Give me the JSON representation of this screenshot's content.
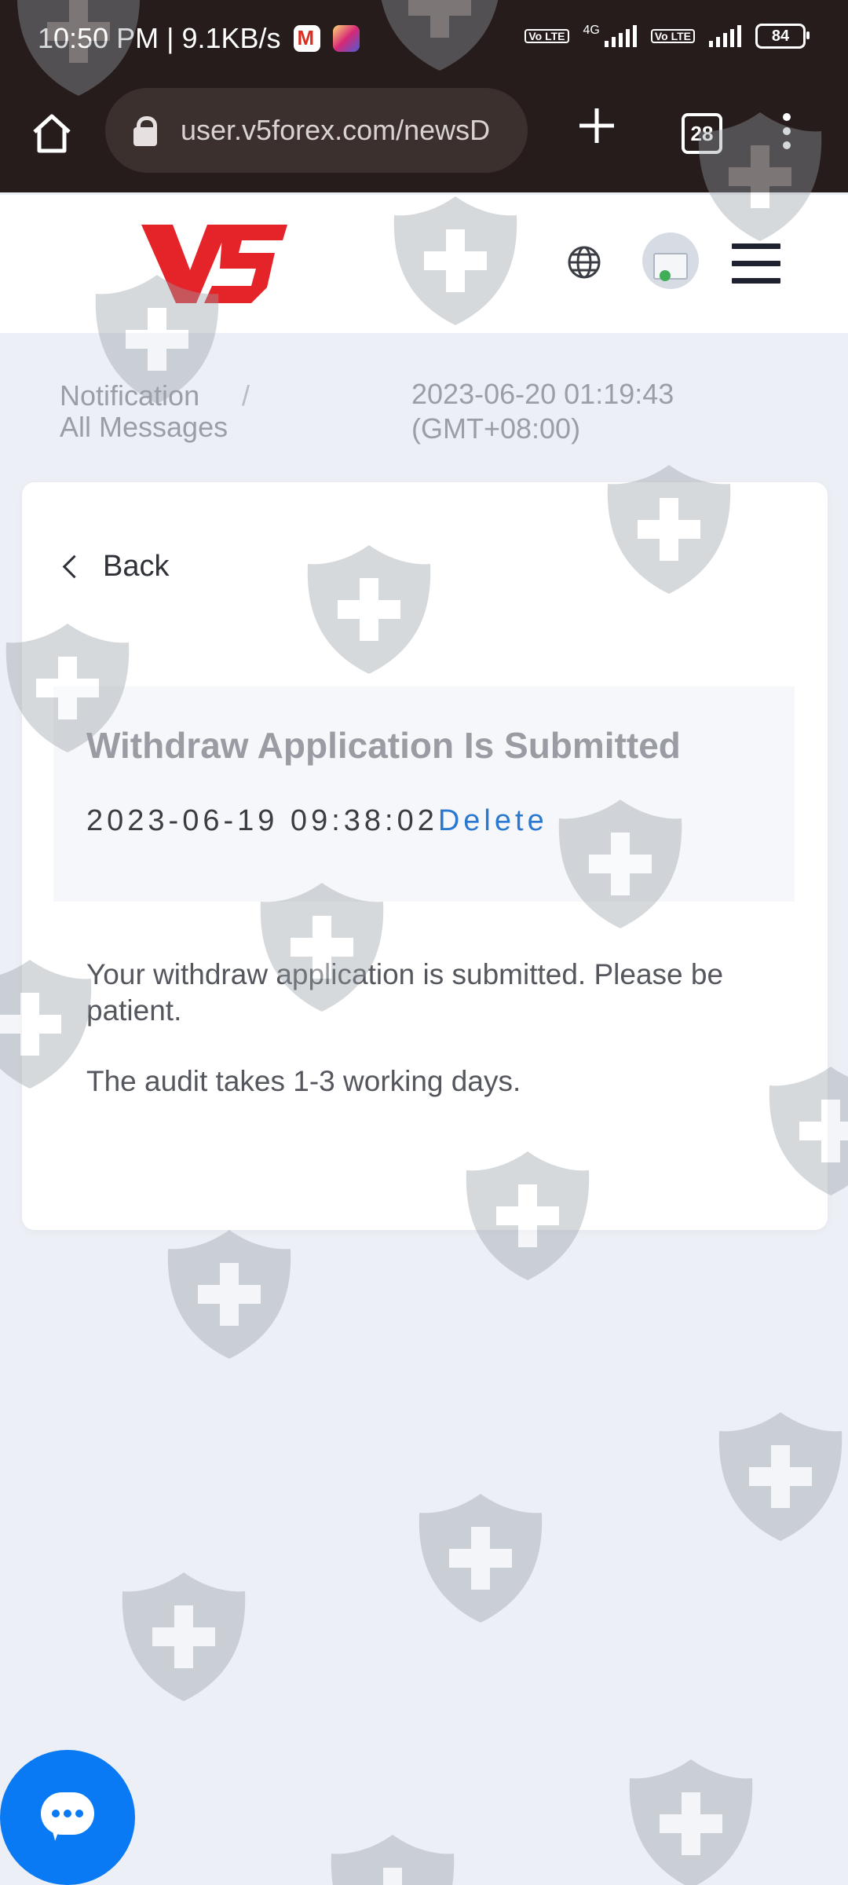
{
  "status_bar": {
    "time_speed": "10:50 PM | 9.1KB/s",
    "network": "4G",
    "volte": "Vo LTE",
    "battery": "84"
  },
  "browser": {
    "url": "user.v5forex.com/newsD",
    "tab_count": "28"
  },
  "site": {
    "logo_text": "V5"
  },
  "breadcrumb": {
    "parent": "Notification",
    "separator": "/",
    "current": "All Messages"
  },
  "server_time": {
    "datetime": "2023-06-20 01:19:43",
    "timezone": "(GMT+08:00)"
  },
  "card": {
    "back_label": "Back",
    "message": {
      "title": "Withdraw Application Is Submitted",
      "timestamp": "2023-06-19 09:38:02",
      "delete_label": "Delete",
      "body": [
        "Your withdraw application is submitted. Please be patient.",
        "The audit takes 1-3 working days."
      ]
    }
  },
  "colors": {
    "brand_red": "#e5242a",
    "link_blue": "#2b78d0",
    "chat_blue": "#0a79f4",
    "browser_bg": "#251c1b"
  },
  "icons": [
    "home-icon",
    "lock-icon",
    "plus-icon",
    "tabs-icon",
    "more-icon",
    "globe-icon",
    "avatar",
    "menu-icon",
    "chevron-left-icon",
    "chat-icon",
    "shield-watermark-icon"
  ]
}
